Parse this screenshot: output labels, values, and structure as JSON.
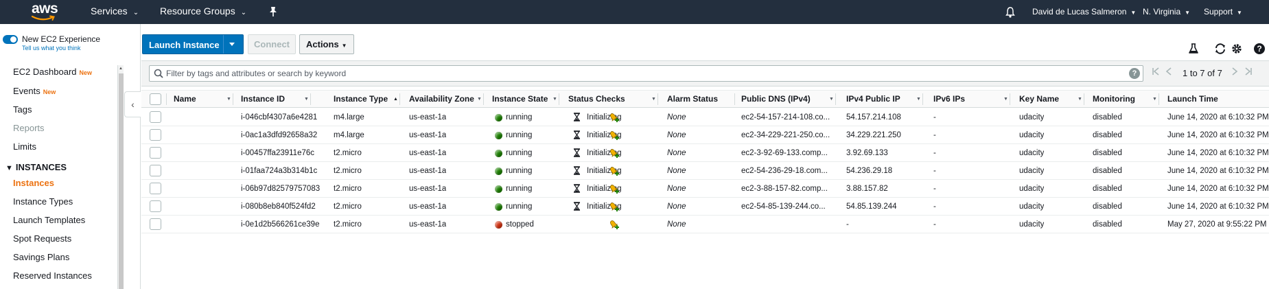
{
  "topnav": {
    "logo_text": "aws",
    "services_label": "Services",
    "resource_groups_label": "Resource Groups",
    "user_label": "David de Lucas Salmeron",
    "region_label": "N. Virginia",
    "support_label": "Support"
  },
  "sidebar": {
    "experience_label": "New EC2 Experience",
    "experience_sub": "Tell us what you think",
    "items": [
      {
        "label": "EC2 Dashboard",
        "badge": "New"
      },
      {
        "label": "Events",
        "badge": "New"
      },
      {
        "label": "Tags"
      },
      {
        "label": "Reports"
      },
      {
        "label": "Limits"
      }
    ],
    "section_label": "INSTANCES",
    "section_items": [
      {
        "label": "Instances"
      },
      {
        "label": "Instance Types"
      },
      {
        "label": "Launch Templates"
      },
      {
        "label": "Spot Requests"
      },
      {
        "label": "Savings Plans"
      },
      {
        "label": "Reserved Instances"
      }
    ]
  },
  "toolbar": {
    "launch_label": "Launch Instance",
    "connect_label": "Connect",
    "actions_label": "Actions"
  },
  "filter": {
    "placeholder": "Filter by tags and attributes or search by keyword",
    "pager_text": "1 to 7 of 7"
  },
  "table": {
    "columns": [
      "Name",
      "Instance ID",
      "Instance Type",
      "Availability Zone",
      "Instance State",
      "Status Checks",
      "Alarm Status",
      "Public DNS (IPv4)",
      "IPv4 Public IP",
      "IPv6 IPs",
      "Key Name",
      "Monitoring",
      "Launch Time"
    ],
    "rows": [
      {
        "name": "",
        "id": "i-046cbf4307a6e4281",
        "type": "m4.large",
        "az": "us-east-1a",
        "state": "running",
        "checks": "Initializing",
        "alarm": "None",
        "dns": "ec2-54-157-214-108.co...",
        "ip": "54.157.214.108",
        "ipv6": "-",
        "key": "udacity",
        "monitoring": "disabled",
        "launch": "June 14, 2020 at 6:10:32 PM"
      },
      {
        "name": "",
        "id": "i-0ac1a3dfd92658a32",
        "type": "m4.large",
        "az": "us-east-1a",
        "state": "running",
        "checks": "Initializing",
        "alarm": "None",
        "dns": "ec2-34-229-221-250.co...",
        "ip": "34.229.221.250",
        "ipv6": "-",
        "key": "udacity",
        "monitoring": "disabled",
        "launch": "June 14, 2020 at 6:10:32 PM"
      },
      {
        "name": "",
        "id": "i-00457ffa23911e76c",
        "type": "t2.micro",
        "az": "us-east-1a",
        "state": "running",
        "checks": "Initializing",
        "alarm": "None",
        "dns": "ec2-3-92-69-133.comp...",
        "ip": "3.92.69.133",
        "ipv6": "-",
        "key": "udacity",
        "monitoring": "disabled",
        "launch": "June 14, 2020 at 6:10:32 PM"
      },
      {
        "name": "",
        "id": "i-01faa724a3b314b1c",
        "type": "t2.micro",
        "az": "us-east-1a",
        "state": "running",
        "checks": "Initializing",
        "alarm": "None",
        "dns": "ec2-54-236-29-18.com...",
        "ip": "54.236.29.18",
        "ipv6": "-",
        "key": "udacity",
        "monitoring": "disabled",
        "launch": "June 14, 2020 at 6:10:32 PM"
      },
      {
        "name": "",
        "id": "i-06b97d82579757083",
        "type": "t2.micro",
        "az": "us-east-1a",
        "state": "running",
        "checks": "Initializing",
        "alarm": "None",
        "dns": "ec2-3-88-157-82.comp...",
        "ip": "3.88.157.82",
        "ipv6": "-",
        "key": "udacity",
        "monitoring": "disabled",
        "launch": "June 14, 2020 at 6:10:32 PM"
      },
      {
        "name": "",
        "id": "i-080b8eb840f524fd2",
        "type": "t2.micro",
        "az": "us-east-1a",
        "state": "running",
        "checks": "Initializing",
        "alarm": "None",
        "dns": "ec2-54-85-139-244.co...",
        "ip": "54.85.139.244",
        "ipv6": "-",
        "key": "udacity",
        "monitoring": "disabled",
        "launch": "June 14, 2020 at 6:10:32 PM"
      },
      {
        "name": "",
        "id": "i-0e1d2b566261ce39e",
        "type": "t2.micro",
        "az": "us-east-1a",
        "state": "stopped",
        "checks": "",
        "alarm": "None",
        "dns": "",
        "ip": "-",
        "ipv6": "-",
        "key": "udacity",
        "monitoring": "disabled",
        "launch": "May 27, 2020 at 9:55:22 PM"
      }
    ]
  },
  "colors": {
    "nav_bg": "#232f3e",
    "primary": "#0073bb",
    "accent_orange": "#ec7211",
    "running": "#1d8102",
    "stopped": "#d13212"
  }
}
